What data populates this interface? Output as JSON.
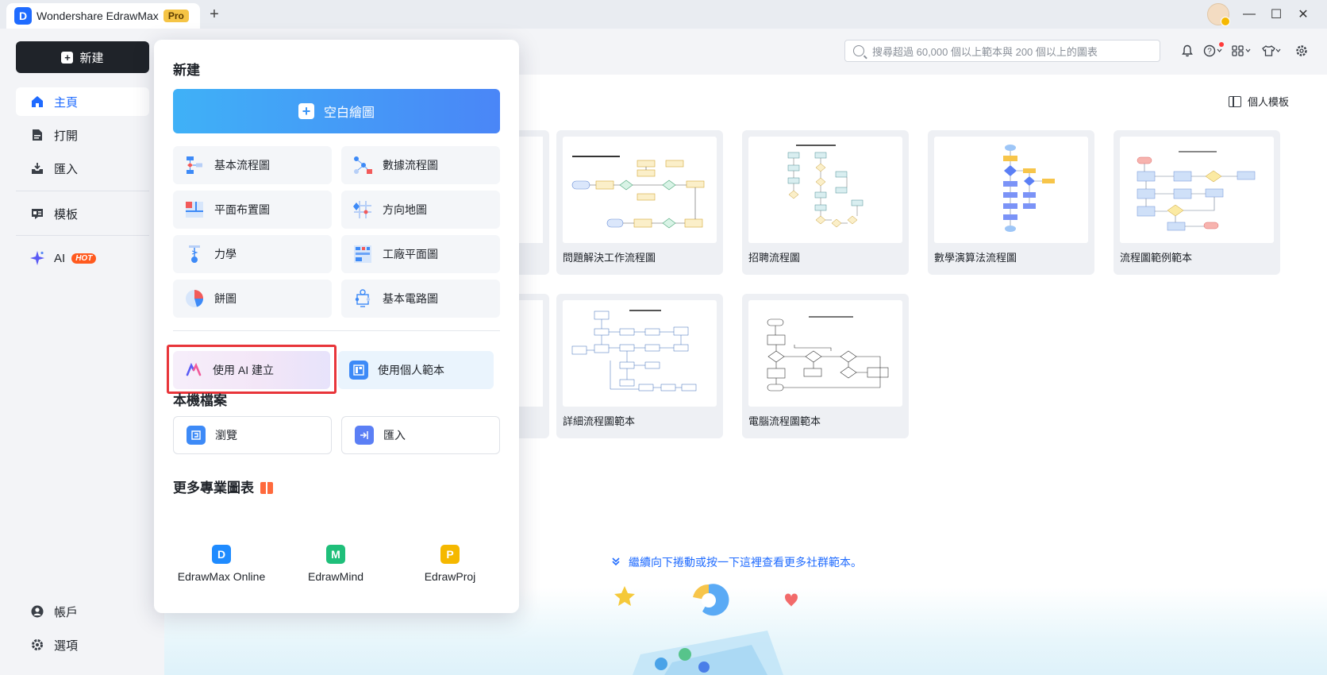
{
  "titlebar": {
    "app_logo": "D",
    "app_name": "Wondershare EdrawMax",
    "pro_badge": "Pro",
    "new_tab": "+",
    "minimize": "—",
    "maximize": "☐",
    "close": "✕"
  },
  "sidebar": {
    "new_label": "新建",
    "items": [
      {
        "label": "主頁",
        "icon": "home-icon"
      },
      {
        "label": "打開",
        "icon": "document-icon"
      },
      {
        "label": "匯入",
        "icon": "import-icon"
      },
      {
        "label": "模板",
        "icon": "template-icon"
      },
      {
        "label": "AI",
        "icon": "sparkle-icon"
      }
    ],
    "hot_badge": "HOT",
    "account_label": "帳戶",
    "options_label": "選項"
  },
  "header": {
    "search_placeholder": "搜尋超過 60,000 個以上範本與 200 個以上的圖表",
    "personal_templates": "個人模板"
  },
  "templates": [
    {
      "label": "問題解決工作流程圖"
    },
    {
      "label": "招聘流程圖"
    },
    {
      "label": "數學演算法流程圖"
    },
    {
      "label": "流程圖範例範本"
    },
    {
      "label": "詳細流程圖範本"
    },
    {
      "label": "電腦流程圖範本"
    }
  ],
  "scroll_hint": "繼續向下捲動或按一下這裡查看更多社群範本。",
  "dropdown": {
    "new_title": "新建",
    "blank_label": "空白繪圖",
    "diagram_types": [
      {
        "label": "基本流程圖",
        "icon": "flowchart-icon"
      },
      {
        "label": "數據流程圖",
        "icon": "data-flow-icon"
      },
      {
        "label": "平面布置圖",
        "icon": "floor-plan-icon"
      },
      {
        "label": "方向地圖",
        "icon": "direction-map-icon"
      },
      {
        "label": "力學",
        "icon": "mechanics-icon"
      },
      {
        "label": "工廠平面圖",
        "icon": "factory-plan-icon"
      },
      {
        "label": "餅圖",
        "icon": "pie-chart-icon"
      },
      {
        "label": "基本電路圖",
        "icon": "circuit-icon"
      }
    ],
    "ai_create": "使用 AI 建立",
    "personal_template": "使用個人範本",
    "local_files_title": "本機檔案",
    "browse_label": "瀏覽",
    "import_label": "匯入",
    "more_title": "更多專業圖表",
    "more_apps": [
      {
        "label": "EdrawMax Online",
        "glyph": "D",
        "color": "#1f8bff"
      },
      {
        "label": "EdrawMind",
        "glyph": "M",
        "color": "#1fbf7a"
      },
      {
        "label": "EdrawProj",
        "glyph": "P",
        "color": "#f5b800"
      }
    ]
  },
  "colors": {
    "accent": "#1f6bff",
    "highlight": "#e8353a"
  }
}
